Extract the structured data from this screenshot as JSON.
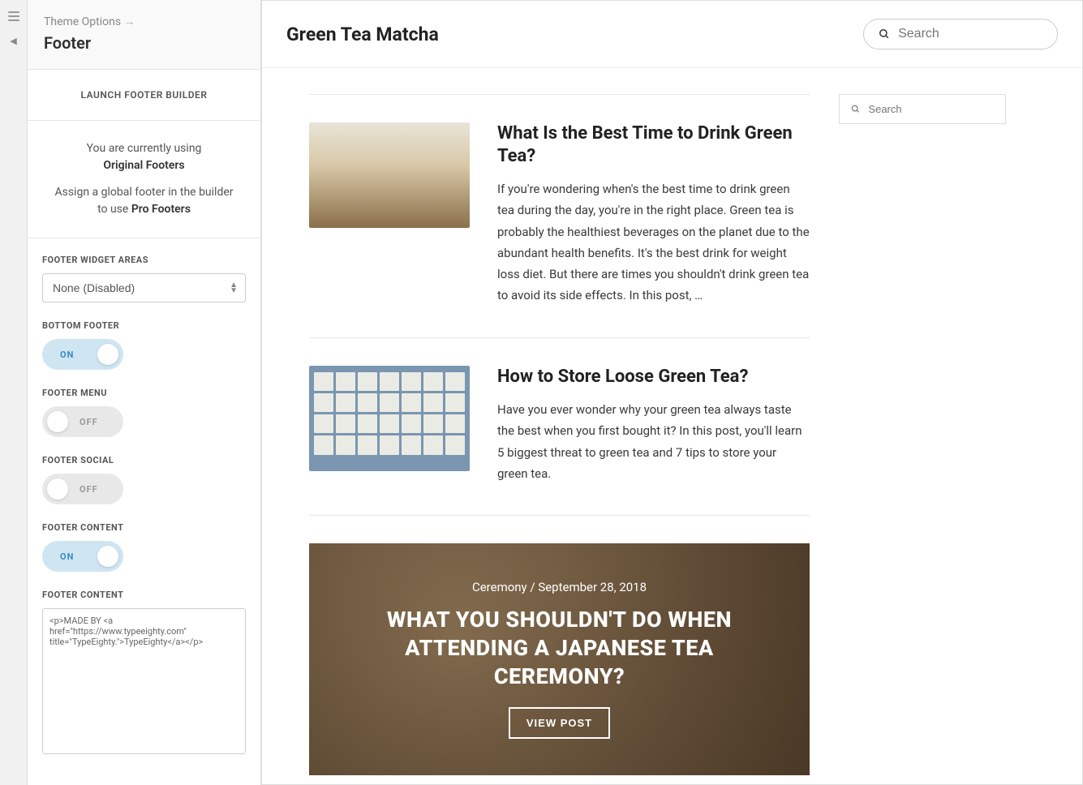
{
  "sidebar": {
    "breadcrumb": "Theme Options",
    "title": "Footer",
    "launch_button": "LAUNCH FOOTER BUILDER",
    "info_line1": "You are currently using",
    "info_original": "Original Footers",
    "info_line2": "Assign a global footer in the builder to use ",
    "info_pro": "Pro Footers",
    "widget_areas_label": "FOOTER WIDGET AREAS",
    "widget_areas_value": "None (Disabled)",
    "bottom_footer_label": "BOTTOM FOOTER",
    "bottom_footer_state": "ON",
    "footer_menu_label": "FOOTER MENU",
    "footer_menu_state": "OFF",
    "footer_social_label": "FOOTER SOCIAL",
    "footer_social_state": "OFF",
    "footer_content_toggle_label": "FOOTER CONTENT",
    "footer_content_toggle_state": "ON",
    "footer_content_text_label": "FOOTER CONTENT",
    "footer_content_value": "<p>MADE BY <a href=\"https://www.typeeighty.com\" title=\"TypeEighty.\">TypeEighty</a></p>"
  },
  "preview": {
    "site_title": "Green Tea Matcha",
    "search_placeholder": "Search",
    "sidebar_search_placeholder": "Search",
    "posts": [
      {
        "title": "What Is the Best Time to Drink Green Tea?",
        "excerpt": "If you're wondering when's the best time to drink green tea during the day, you're in the right place. Green tea is probably the healthiest beverages on the planet due to the abundant health benefits. It's the best drink for weight loss diet. But there are times you shouldn't drink green tea to avoid its side effects. In this post, …"
      },
      {
        "title": "How to Store Loose Green Tea?",
        "excerpt": "Have you ever wonder why your green tea always taste the best when you first bought it? In this post, you'll learn 5 biggest threat to green tea and 7 tips to store your green tea."
      }
    ],
    "hero": {
      "category": "Ceremony",
      "date": "September 28, 2018",
      "title": "WHAT YOU SHOULDN'T DO WHEN ATTENDING A JAPANESE TEA CEREMONY?",
      "button": "VIEW POST"
    }
  }
}
